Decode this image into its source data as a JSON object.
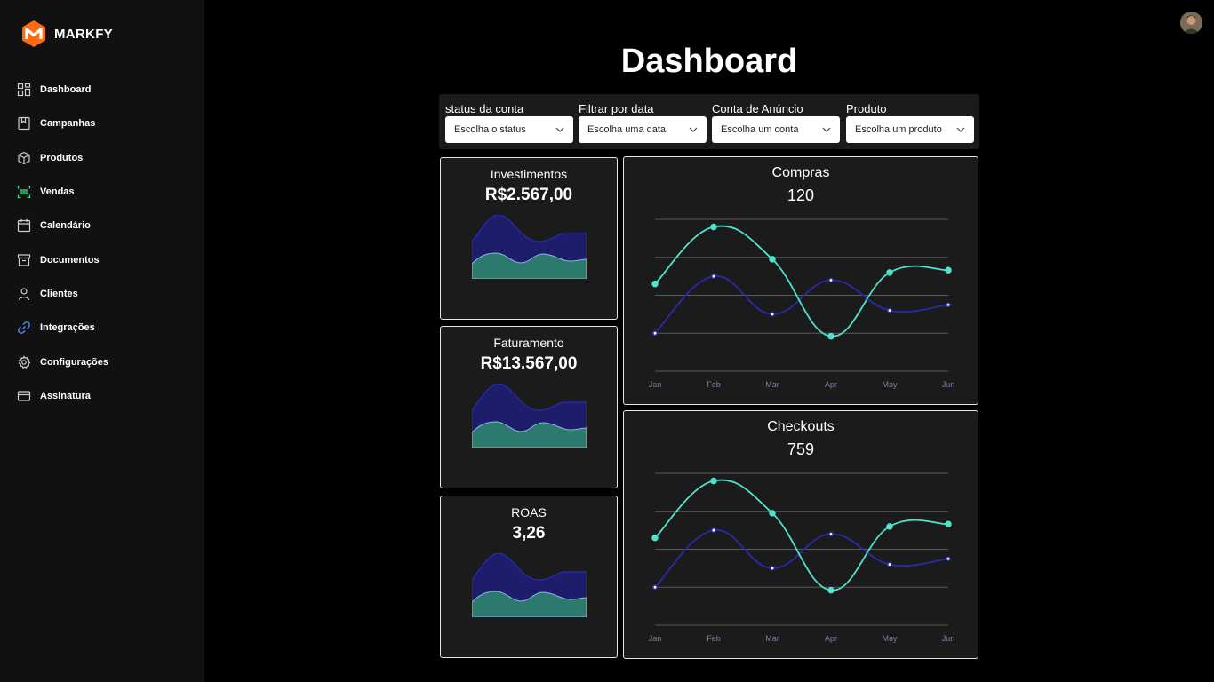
{
  "app": {
    "name": "MARKFY",
    "brand_color": "#ff6a13"
  },
  "sidebar": {
    "items": [
      {
        "label": "Dashboard",
        "icon": "grid-icon"
      },
      {
        "label": "Campanhas",
        "icon": "bookmark-icon"
      },
      {
        "label": "Produtos",
        "icon": "box-icon"
      },
      {
        "label": "Vendas",
        "icon": "barcode-scan-icon"
      },
      {
        "label": "Calendário",
        "icon": "calendar-icon"
      },
      {
        "label": "Documentos",
        "icon": "archive-icon"
      },
      {
        "label": "Clientes",
        "icon": "user-icon"
      },
      {
        "label": "Integrações",
        "icon": "link-icon"
      },
      {
        "label": "Configurações",
        "icon": "gear-icon"
      },
      {
        "label": "Assinatura",
        "icon": "credit-card-icon"
      }
    ]
  },
  "header": {
    "title": "Dashboard"
  },
  "filters": [
    {
      "label": "status da conta",
      "value": "Escolha o status"
    },
    {
      "label": "Filtrar por data",
      "value": "Escolha uma data"
    },
    {
      "label": "Conta de Anúncio",
      "value": "Escolha um conta"
    },
    {
      "label": "Produto",
      "value": "Escolha um produto"
    }
  ],
  "stats": [
    {
      "title": "Investimentos",
      "value": "R$2.567,00"
    },
    {
      "title": "Faturamento",
      "value": "R$13.567,00"
    },
    {
      "title": "ROAS",
      "value": "3,26"
    }
  ],
  "colors": {
    "teal": "#4de3cc",
    "navy": "#1f1e8f",
    "navy_fill": "#1e1d6b",
    "teal_fill": "#2c7a6e"
  },
  "chart_data": [
    {
      "type": "line",
      "title": "Compras",
      "value": "120",
      "categories": [
        "Jan",
        "Feb",
        "Mar",
        "Apr",
        "May",
        "Jun"
      ],
      "ylim": [
        0,
        4
      ],
      "grid": true,
      "series": [
        {
          "values": [
            2.3,
            3.8,
            2.95,
            0.92,
            2.6,
            2.66
          ],
          "color": "#4de3cc"
        },
        {
          "values": [
            1.0,
            2.5,
            1.5,
            2.4,
            1.6,
            1.75
          ],
          "color": "#2a2aa8"
        }
      ]
    },
    {
      "type": "line",
      "title": "Checkouts",
      "value": "759",
      "categories": [
        "Jan",
        "Feb",
        "Mar",
        "Apr",
        "May",
        "Jun"
      ],
      "ylim": [
        0,
        4
      ],
      "grid": true,
      "series": [
        {
          "values": [
            2.3,
            3.8,
            2.95,
            0.92,
            2.6,
            2.66
          ],
          "color": "#4de3cc"
        },
        {
          "values": [
            1.0,
            2.5,
            1.5,
            2.4,
            1.6,
            1.75
          ],
          "color": "#2a2aa8"
        }
      ]
    }
  ]
}
